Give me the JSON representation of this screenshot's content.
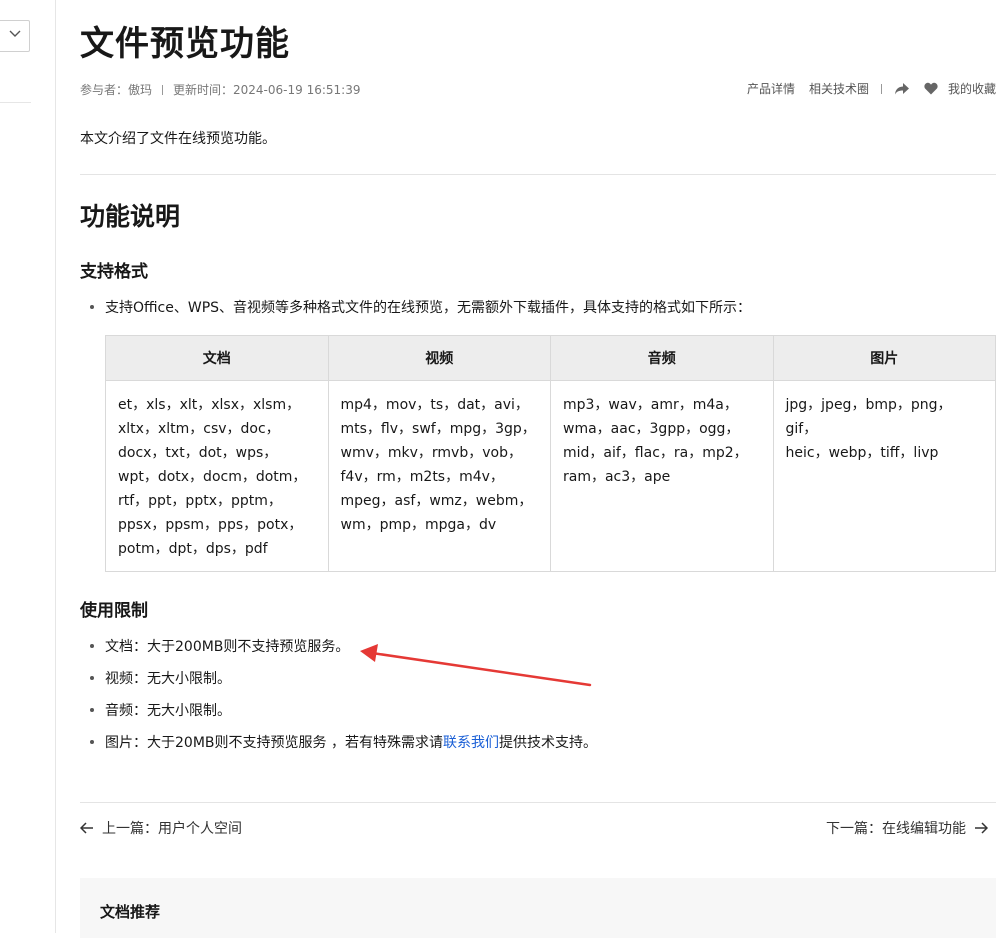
{
  "page": {
    "title": "文件预览功能",
    "meta": {
      "contributors": "参与者：傲玛",
      "updated": "更新时间：2024-06-19 16:51:39"
    },
    "actions": {
      "product_details": "产品详情",
      "related_circle": "相关技术圈",
      "favorites": "我的收藏"
    },
    "intro": "本文介绍了文件在线预览功能。"
  },
  "section": {
    "heading": "功能说明",
    "formats": {
      "heading": "支持格式",
      "bullet": "支持Office、WPS、音视频等多种格式文件的在线预览，无需额外下载插件，具体支持的格式如下所示：",
      "table": {
        "headers": [
          "文档",
          "视频",
          "音频",
          "图片"
        ],
        "cells": [
          [
            "et，xls，xlt，xlsx，xlsm，",
            "xltx，xltm，csv，doc，",
            "docx，txt，dot，wps，",
            "wpt，dotx，docm，dotm，",
            "rtf，ppt，pptx，pptm，",
            "ppsx，ppsm，pps，potx，",
            "potm，dpt，dps，pdf"
          ],
          [
            "mp4，mov，ts，dat，avi，",
            "mts，flv，swf，mpg，3gp，",
            "wmv，mkv，rmvb，vob，",
            "f4v，rm，m2ts，m4v，",
            "mpeg，asf，wmz，webm，",
            "wm，pmp，mpga，dv"
          ],
          [
            "mp3，wav，amr，m4a，",
            "wma，aac，3gpp，ogg，",
            "mid，aif，flac，ra，mp2，",
            "ram，ac3，ape"
          ],
          [
            "jpg，jpeg，bmp，png，gif，",
            "heic，webp，tiff，livp"
          ]
        ]
      }
    },
    "limits": {
      "heading": "使用限制",
      "items": [
        "文档：大于200MB则不支持预览服务。",
        "视频：无大小限制。",
        "音频：无大小限制。"
      ],
      "last_item": {
        "prefix": "图片：大于20MB则不支持预览服务 ，若有特殊需求请",
        "link": "联系我们",
        "suffix": "提供技术支持。"
      }
    }
  },
  "nav": {
    "prev": "上一篇：用户个人空间",
    "next": "下一篇：在线编辑功能"
  },
  "recommend": {
    "title": "文档推荐"
  },
  "colors": {
    "annotation_arrow": "#e53935",
    "link": "#1a5fd6"
  }
}
